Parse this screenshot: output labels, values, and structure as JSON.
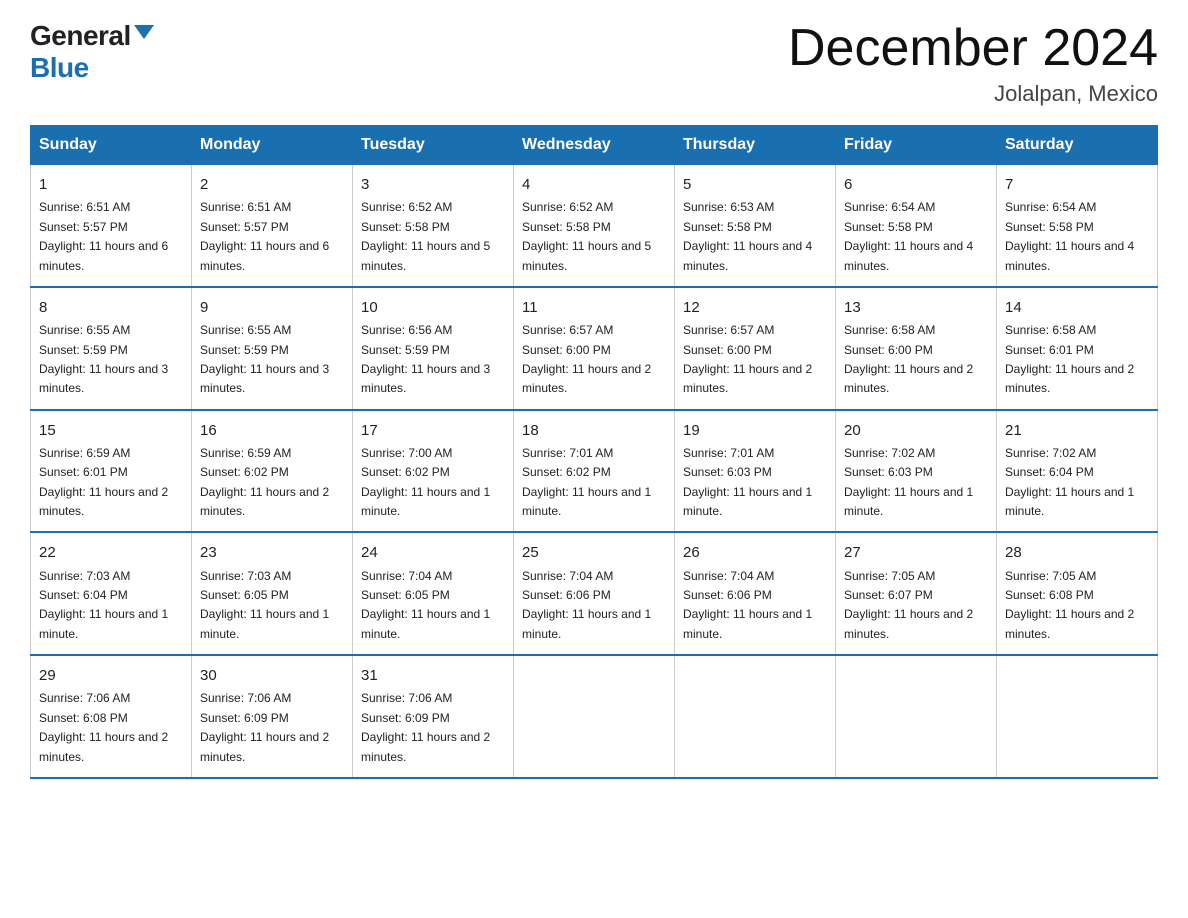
{
  "header": {
    "logo_general": "General",
    "logo_blue": "Blue",
    "title": "December 2024",
    "subtitle": "Jolalpan, Mexico"
  },
  "days_of_week": [
    "Sunday",
    "Monday",
    "Tuesday",
    "Wednesday",
    "Thursday",
    "Friday",
    "Saturday"
  ],
  "weeks": [
    [
      {
        "day": "1",
        "sunrise": "6:51 AM",
        "sunset": "5:57 PM",
        "daylight": "11 hours and 6 minutes."
      },
      {
        "day": "2",
        "sunrise": "6:51 AM",
        "sunset": "5:57 PM",
        "daylight": "11 hours and 6 minutes."
      },
      {
        "day": "3",
        "sunrise": "6:52 AM",
        "sunset": "5:58 PM",
        "daylight": "11 hours and 5 minutes."
      },
      {
        "day": "4",
        "sunrise": "6:52 AM",
        "sunset": "5:58 PM",
        "daylight": "11 hours and 5 minutes."
      },
      {
        "day": "5",
        "sunrise": "6:53 AM",
        "sunset": "5:58 PM",
        "daylight": "11 hours and 4 minutes."
      },
      {
        "day": "6",
        "sunrise": "6:54 AM",
        "sunset": "5:58 PM",
        "daylight": "11 hours and 4 minutes."
      },
      {
        "day": "7",
        "sunrise": "6:54 AM",
        "sunset": "5:58 PM",
        "daylight": "11 hours and 4 minutes."
      }
    ],
    [
      {
        "day": "8",
        "sunrise": "6:55 AM",
        "sunset": "5:59 PM",
        "daylight": "11 hours and 3 minutes."
      },
      {
        "day": "9",
        "sunrise": "6:55 AM",
        "sunset": "5:59 PM",
        "daylight": "11 hours and 3 minutes."
      },
      {
        "day": "10",
        "sunrise": "6:56 AM",
        "sunset": "5:59 PM",
        "daylight": "11 hours and 3 minutes."
      },
      {
        "day": "11",
        "sunrise": "6:57 AM",
        "sunset": "6:00 PM",
        "daylight": "11 hours and 2 minutes."
      },
      {
        "day": "12",
        "sunrise": "6:57 AM",
        "sunset": "6:00 PM",
        "daylight": "11 hours and 2 minutes."
      },
      {
        "day": "13",
        "sunrise": "6:58 AM",
        "sunset": "6:00 PM",
        "daylight": "11 hours and 2 minutes."
      },
      {
        "day": "14",
        "sunrise": "6:58 AM",
        "sunset": "6:01 PM",
        "daylight": "11 hours and 2 minutes."
      }
    ],
    [
      {
        "day": "15",
        "sunrise": "6:59 AM",
        "sunset": "6:01 PM",
        "daylight": "11 hours and 2 minutes."
      },
      {
        "day": "16",
        "sunrise": "6:59 AM",
        "sunset": "6:02 PM",
        "daylight": "11 hours and 2 minutes."
      },
      {
        "day": "17",
        "sunrise": "7:00 AM",
        "sunset": "6:02 PM",
        "daylight": "11 hours and 1 minute."
      },
      {
        "day": "18",
        "sunrise": "7:01 AM",
        "sunset": "6:02 PM",
        "daylight": "11 hours and 1 minute."
      },
      {
        "day": "19",
        "sunrise": "7:01 AM",
        "sunset": "6:03 PM",
        "daylight": "11 hours and 1 minute."
      },
      {
        "day": "20",
        "sunrise": "7:02 AM",
        "sunset": "6:03 PM",
        "daylight": "11 hours and 1 minute."
      },
      {
        "day": "21",
        "sunrise": "7:02 AM",
        "sunset": "6:04 PM",
        "daylight": "11 hours and 1 minute."
      }
    ],
    [
      {
        "day": "22",
        "sunrise": "7:03 AM",
        "sunset": "6:04 PM",
        "daylight": "11 hours and 1 minute."
      },
      {
        "day": "23",
        "sunrise": "7:03 AM",
        "sunset": "6:05 PM",
        "daylight": "11 hours and 1 minute."
      },
      {
        "day": "24",
        "sunrise": "7:04 AM",
        "sunset": "6:05 PM",
        "daylight": "11 hours and 1 minute."
      },
      {
        "day": "25",
        "sunrise": "7:04 AM",
        "sunset": "6:06 PM",
        "daylight": "11 hours and 1 minute."
      },
      {
        "day": "26",
        "sunrise": "7:04 AM",
        "sunset": "6:06 PM",
        "daylight": "11 hours and 1 minute."
      },
      {
        "day": "27",
        "sunrise": "7:05 AM",
        "sunset": "6:07 PM",
        "daylight": "11 hours and 2 minutes."
      },
      {
        "day": "28",
        "sunrise": "7:05 AM",
        "sunset": "6:08 PM",
        "daylight": "11 hours and 2 minutes."
      }
    ],
    [
      {
        "day": "29",
        "sunrise": "7:06 AM",
        "sunset": "6:08 PM",
        "daylight": "11 hours and 2 minutes."
      },
      {
        "day": "30",
        "sunrise": "7:06 AM",
        "sunset": "6:09 PM",
        "daylight": "11 hours and 2 minutes."
      },
      {
        "day": "31",
        "sunrise": "7:06 AM",
        "sunset": "6:09 PM",
        "daylight": "11 hours and 2 minutes."
      },
      null,
      null,
      null,
      null
    ]
  ],
  "labels": {
    "sunrise": "Sunrise:",
    "sunset": "Sunset:",
    "daylight": "Daylight:"
  }
}
